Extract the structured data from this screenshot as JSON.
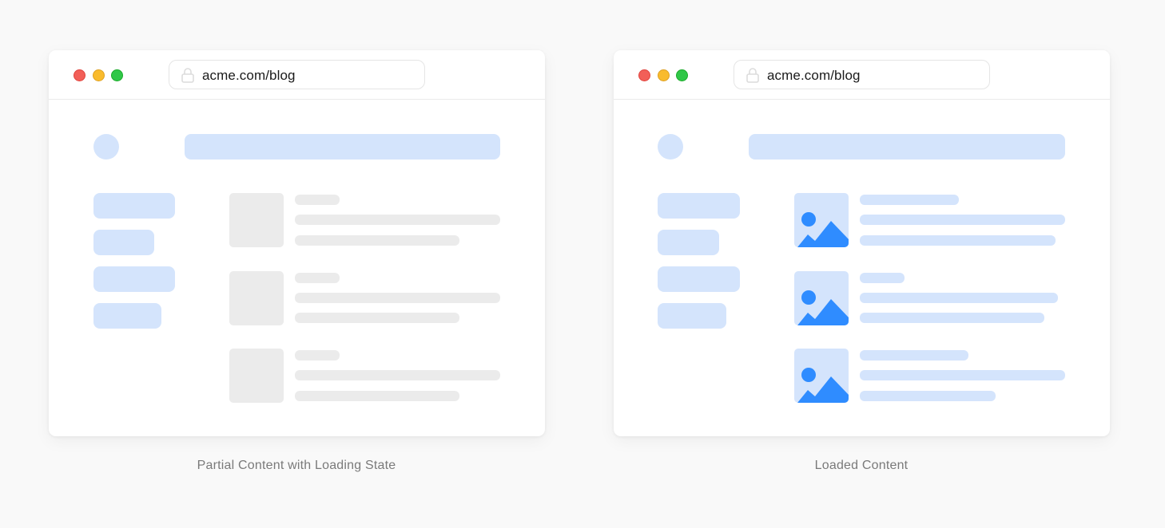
{
  "windows": [
    {
      "url": "acme.com/blog",
      "caption": "Partial Content with Loading State",
      "state": "loading",
      "thumbnail_style": "placeholder"
    },
    {
      "url": "acme.com/blog",
      "caption": "Loaded Content",
      "state": "loaded",
      "thumbnail_style": "image-icon"
    }
  ],
  "colors": {
    "background": "#f9f9f9",
    "window": "#ffffff",
    "skeleton_blue": "#d4e4fc",
    "skeleton_gray": "#ebebeb",
    "image_icon": "#2f8cff",
    "traffic_red": "#f25f58",
    "traffic_yellow": "#f9bb2d",
    "traffic_green": "#30c748"
  },
  "icons": [
    "lock-icon",
    "image-icon"
  ]
}
